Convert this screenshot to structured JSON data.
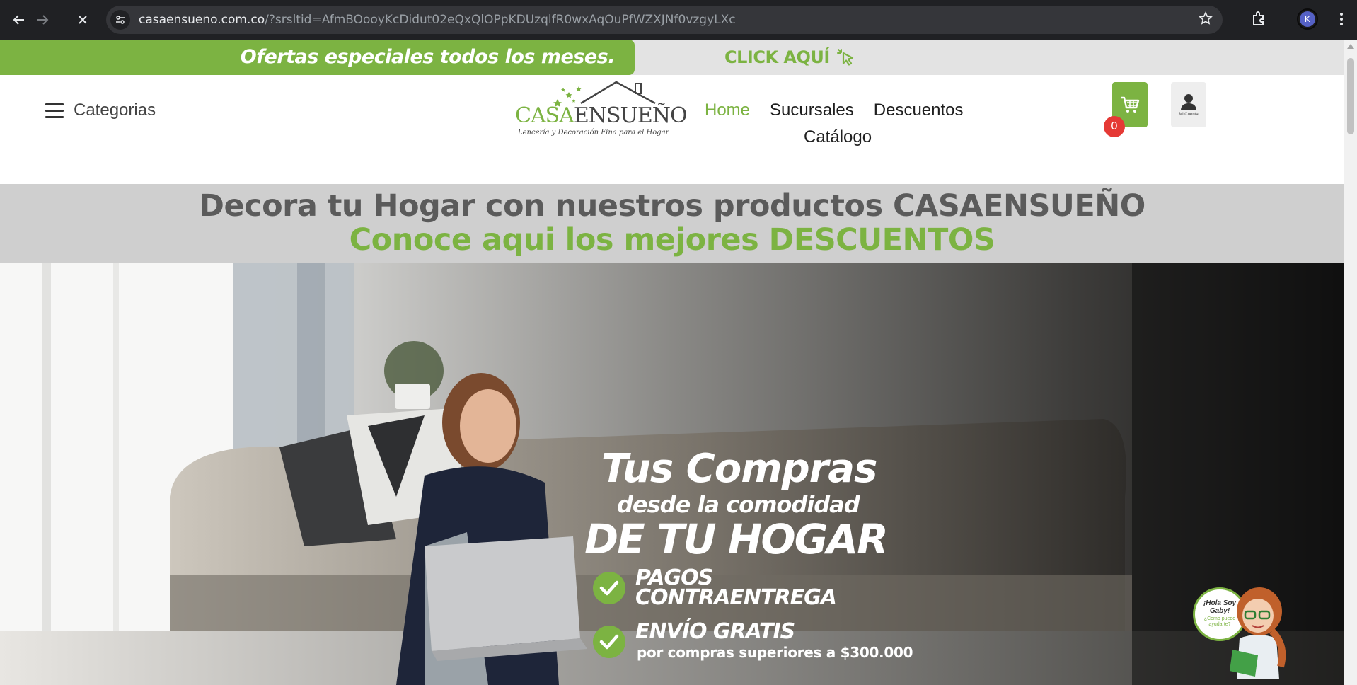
{
  "browser": {
    "url_domain": "casaensueno.com.co",
    "url_rest": "/?srsltid=AfmBOooyKcDidut02eQxQlOPpKDUzqlfR0wxAqOuPfWZXJNf0vzgyLXc",
    "profile_initial": "K",
    "icons": [
      "back-arrow-icon",
      "forward-arrow-icon",
      "stop-loading-icon",
      "site-settings-icon",
      "bookmark-star-icon",
      "extensions-icon",
      "more-menu-icon"
    ]
  },
  "promo": {
    "text": "Ofertas especiales todos los meses.",
    "cta": "CLICK AQUÍ"
  },
  "header": {
    "categories_label": "Categorias",
    "logo": {
      "word_a": "CASA",
      "word_b": "EN",
      "word_c": "SUEÑO",
      "tagline": "Lencería y Decoración Fina para el Hogar"
    },
    "nav": [
      {
        "label": "Home",
        "active": true
      },
      {
        "label": "Sucursales",
        "active": false
      },
      {
        "label": "Descuentos",
        "active": false
      },
      {
        "label": "Catálogo",
        "active": false
      }
    ],
    "cart_count": "0",
    "account_label": "Mi Cuenta"
  },
  "headline": {
    "line1": "Decora tu Hogar con nuestros productos CASAENSUEÑO",
    "line2": "Conoce aqui los mejores DESCUENTOS"
  },
  "hero": {
    "title1": "Tus Compras",
    "title2": "desde la comodidad",
    "title3": "DE TU HOGAR",
    "feature1_line1": "PAGOS",
    "feature1_line2": "CONTRAENTREGA",
    "feature2_line1": "ENVÍO GRATIS",
    "feature2_line2": "por compras superiores a $300.000"
  },
  "assistant": {
    "greeting": "¡Hola Soy Gaby!",
    "question": "¿Como puedo ayudarte?"
  },
  "colors": {
    "brand_green": "#7cb342",
    "badge_red": "#e53935",
    "headline_grey": "#5b5b5b"
  }
}
